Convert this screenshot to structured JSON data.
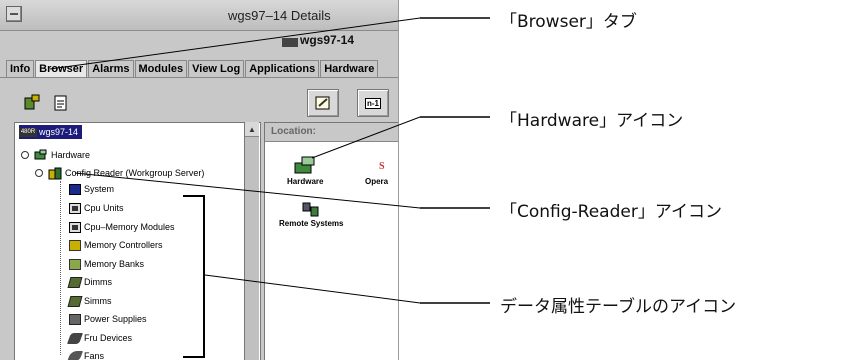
{
  "window": {
    "title": "wgs97–14 Details",
    "host_name": "wgs97-14"
  },
  "tabs": [
    "Info",
    "Browser",
    "Alarms",
    "Modules",
    "View Log",
    "Applications",
    "Hardware"
  ],
  "toolbar": {
    "right_btn2_label": "n-1"
  },
  "tree": {
    "root": "wgs97-14",
    "root_badge": "480R",
    "hardware": "Hardware",
    "config_reader": "Config Reader (Workgroup Server)",
    "items": [
      "System",
      "Cpu Units",
      "Cpu–Memory Modules",
      "Memory Controllers",
      "Memory Banks",
      "Dimms",
      "Simms",
      "Power Supplies",
      "Fru Devices",
      "Fans"
    ]
  },
  "right_pane": {
    "location_label": "Location:",
    "icons": [
      "Hardware",
      "Opera",
      "Remote Systems"
    ]
  },
  "callouts": {
    "browser_tab": "「Browser」タブ",
    "hardware_icon": "「Hardware」アイコン",
    "config_reader_icon": "「Config-Reader」アイコン",
    "data_table_icons": "データ属性テーブルのアイコン"
  }
}
